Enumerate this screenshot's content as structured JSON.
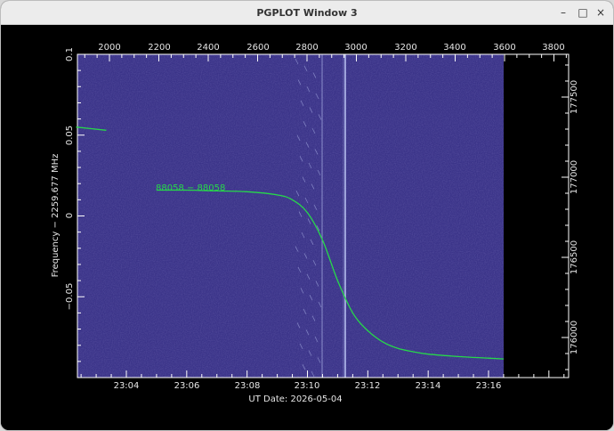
{
  "window": {
    "title": "PGPLOT Window 3",
    "controls": {
      "minimize": "–",
      "maximize": "□",
      "close": "×"
    }
  },
  "plot": {
    "xlabel": "UT Date: 2026-05-04",
    "ylabel": "Frequency − 2259.677 MHz",
    "trace_label": "88058 − 88058",
    "colors": {
      "background": "#3b3489",
      "trace": "#27d84a",
      "axes": "#ffffff",
      "interference": "#c9d4ff"
    }
  },
  "chart_data": {
    "type": "line",
    "title": "",
    "bottom_axis": {
      "ticks": [
        "23:04",
        "23:06",
        "23:08",
        "23:10",
        "23:12",
        "23:14",
        "23:16"
      ],
      "label": "UT Date: 2026-05-04"
    },
    "top_axis": {
      "ticks": [
        "2000",
        "2200",
        "2400",
        "2600",
        "2800",
        "3000",
        "3200",
        "3400",
        "3600",
        "3800"
      ]
    },
    "left_axis": {
      "ticks": [
        "0.1",
        "0.05",
        "0",
        "−0.05"
      ],
      "label": "Frequency − 2259.677 MHz",
      "ylim": [
        -0.1,
        0.1
      ]
    },
    "right_axis": {
      "ticks": [
        "177500",
        "177000",
        "176500",
        "176000"
      ]
    },
    "series": [
      {
        "name": "88058 − 88058",
        "x": [
          "23:02:20",
          "23:03:20",
          "23:05:00",
          "23:06:00",
          "23:07:00",
          "23:08:00",
          "23:09:00",
          "23:09:30",
          "23:10:00",
          "23:10:30",
          "23:11:00",
          "23:11:30",
          "23:12:00",
          "23:12:30",
          "23:13:00",
          "23:13:30",
          "23:14:00",
          "23:15:00",
          "23:16:00",
          "23:16:30"
        ],
        "y": [
          0.055,
          0.053,
          0.016,
          0.016,
          0.0155,
          0.015,
          0.013,
          0.01,
          0.002,
          -0.015,
          -0.04,
          -0.06,
          -0.071,
          -0.078,
          -0.082,
          -0.084,
          -0.0855,
          -0.087,
          -0.088,
          -0.0885
        ]
      }
    ]
  }
}
